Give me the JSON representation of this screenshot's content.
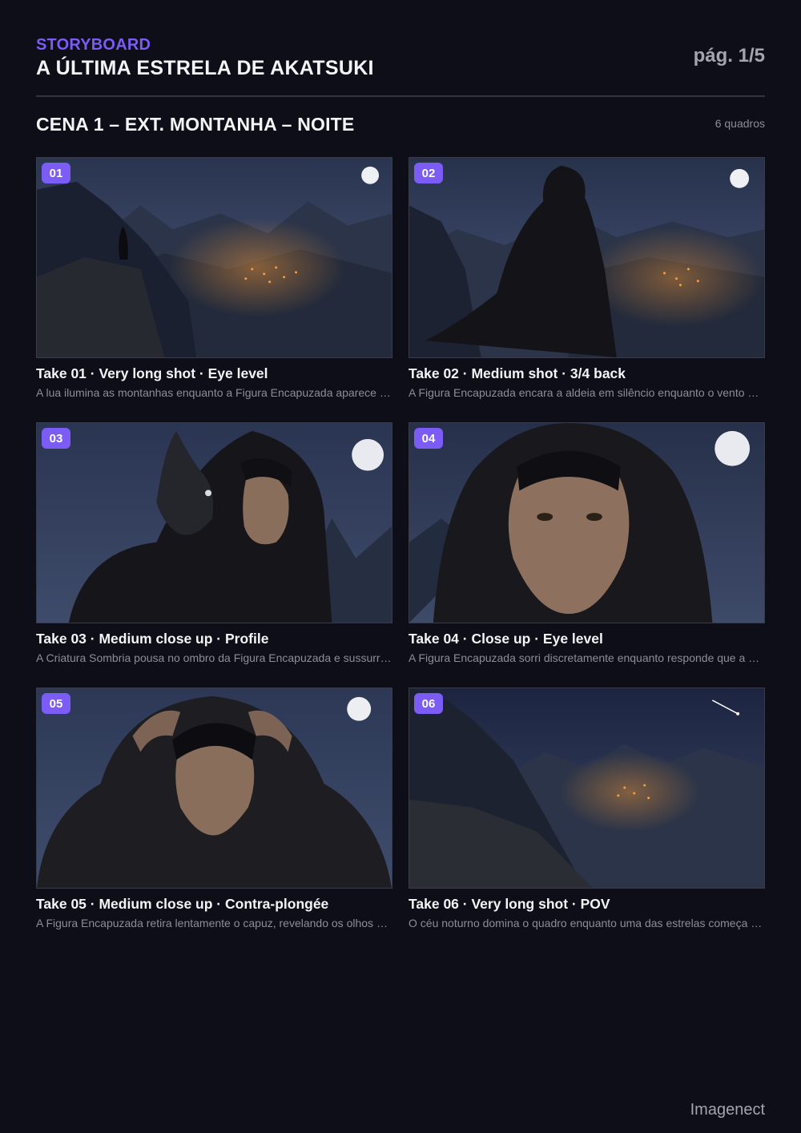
{
  "header": {
    "kicker": "STORYBOARD",
    "title": "A ÚLTIMA ESTRELA DE AKATSUKI",
    "page": "pág. 1/5"
  },
  "scene": {
    "title": "CENA 1 – EXT. MONTANHA – NOITE",
    "count": "6 quadros"
  },
  "frames": [
    {
      "number": "01",
      "take": "Take 01 · Very long shot · Eye level",
      "description": "A lua ilumina as montanhas enquanto a Figura Encapuzada aparece no alto do penhasco.",
      "image": "hooded figure on cliff overlooking lit village valley under full moon"
    },
    {
      "number": "02",
      "take": "Take 02 · Medium shot · 3/4 back",
      "description": "A Figura Encapuzada encara a aldeia em silêncio enquanto o vento agita a capa.",
      "image": "hooded figure from behind, cloak blowing, village lights below"
    },
    {
      "number": "03",
      "take": "Take 03 · Medium close up · Profile",
      "description": "A Criatura Sombria pousa no ombro da Figura Encapuzada e sussurra algo.",
      "image": "hooded man in profile with small winged creature on shoulder"
    },
    {
      "number": "04",
      "take": "Take 04 · Close up · Eye level",
      "description": "A Figura Encapuzada sorri discretamente enquanto responde que a hora chegou.",
      "image": "close up of hooded man with scar, full moon behind"
    },
    {
      "number": "05",
      "take": "Take 05 · Medium close up · Contra-plongée",
      "description": "A Figura Encapuzada retira lentamente o capuz, revelando os olhos sob o luar.",
      "image": "man pulling back hood, low angle, full moon"
    },
    {
      "number": "06",
      "take": "Take 06 · Very long shot · POV",
      "description": "O céu noturno domina o quadro enquanto uma das estrelas começa a cair.",
      "image": "night mountain valley with village and shooting star"
    }
  ],
  "footer": {
    "brand": "Imagenect"
  },
  "colors": {
    "background": "#0e0e18",
    "accent": "#7b5cf5",
    "muted": "#8d8d98"
  }
}
